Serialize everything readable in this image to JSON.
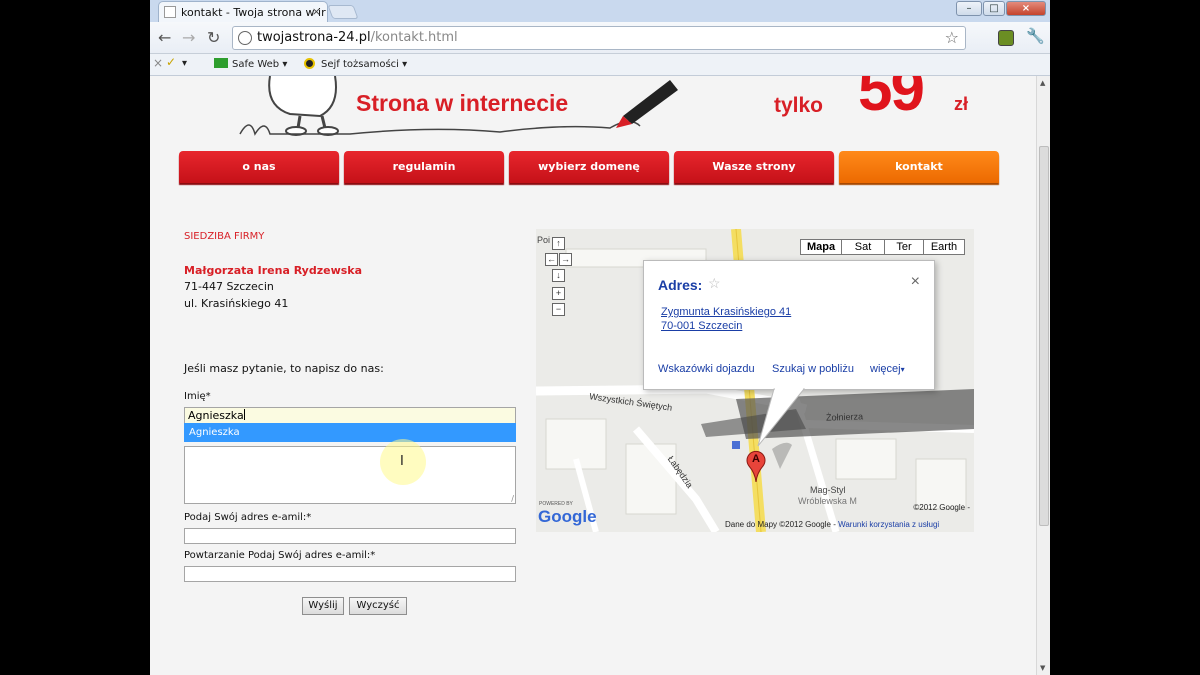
{
  "browser": {
    "tab_title": "kontakt - Twoja strona w ir",
    "tab_close": "×",
    "url_host": "twojastrona-24.pl",
    "url_path": "/kontakt.html",
    "bookmarks": [
      "Safe Web",
      "Sejf tożsamości"
    ],
    "bookmark_arrow": "▾",
    "win_min": "–",
    "win_max": "□",
    "win_close": "×"
  },
  "banner": {
    "title": "Strona w internecie",
    "price_label": "tylko",
    "price": "59",
    "currency": "zł"
  },
  "nav": {
    "items": [
      "o nas",
      "regulamin",
      "wybierz domenę",
      "Wasze strony",
      "kontakt"
    ],
    "active_index": 4
  },
  "company": {
    "heading": "SIEDZIBA FIRMY",
    "name": "Małgorzata Irena Rydzewska",
    "postal": "71-447 Szczecin",
    "street": "ul. Krasińskiego 41"
  },
  "form": {
    "intro": "Jeśli masz pytanie, to napisz do nas:",
    "name_label": "Imię*",
    "name_value": "Agnieszka",
    "autocomplete_option": "Agnieszka",
    "email_label": "Podaj Swój adres e-amil:*",
    "email_repeat_label": "Powtarzanie Podaj Swój adres e-amil:*",
    "send_label": "Wyślij",
    "clear_label": "Wyczyść"
  },
  "map": {
    "types": [
      "Mapa",
      "Sat",
      "Ter",
      "Earth"
    ],
    "active_type": "Mapa",
    "info_title": "Adres:",
    "info_close": "×",
    "info_address_line1": "Zygmunta Krasińskiego 41",
    "info_address_line2": "70-001 Szczecin",
    "info_links": [
      "Wskazówki dojazdu",
      "Szukaj w pobliżu",
      "więcej"
    ],
    "more_arrow": "▾",
    "marker_label": "A",
    "street_labels": [
      "Wszystkich Świętych",
      "Łabędzia",
      "Żołnierza",
      "Mag-Styl",
      "Wróblewska M"
    ],
    "copyright": "©2012 Google -",
    "footer": "Dane do Mapy ©2012 Google -",
    "terms_link": "Warunki korzystania z usługi",
    "powered_by": "POWERED BY",
    "google_logo": "Google",
    "partial_label": "Poi"
  },
  "colors": {
    "brand_red": "#d81f26",
    "nav_active": "#f07800",
    "link_blue": "#1a3ea6"
  }
}
